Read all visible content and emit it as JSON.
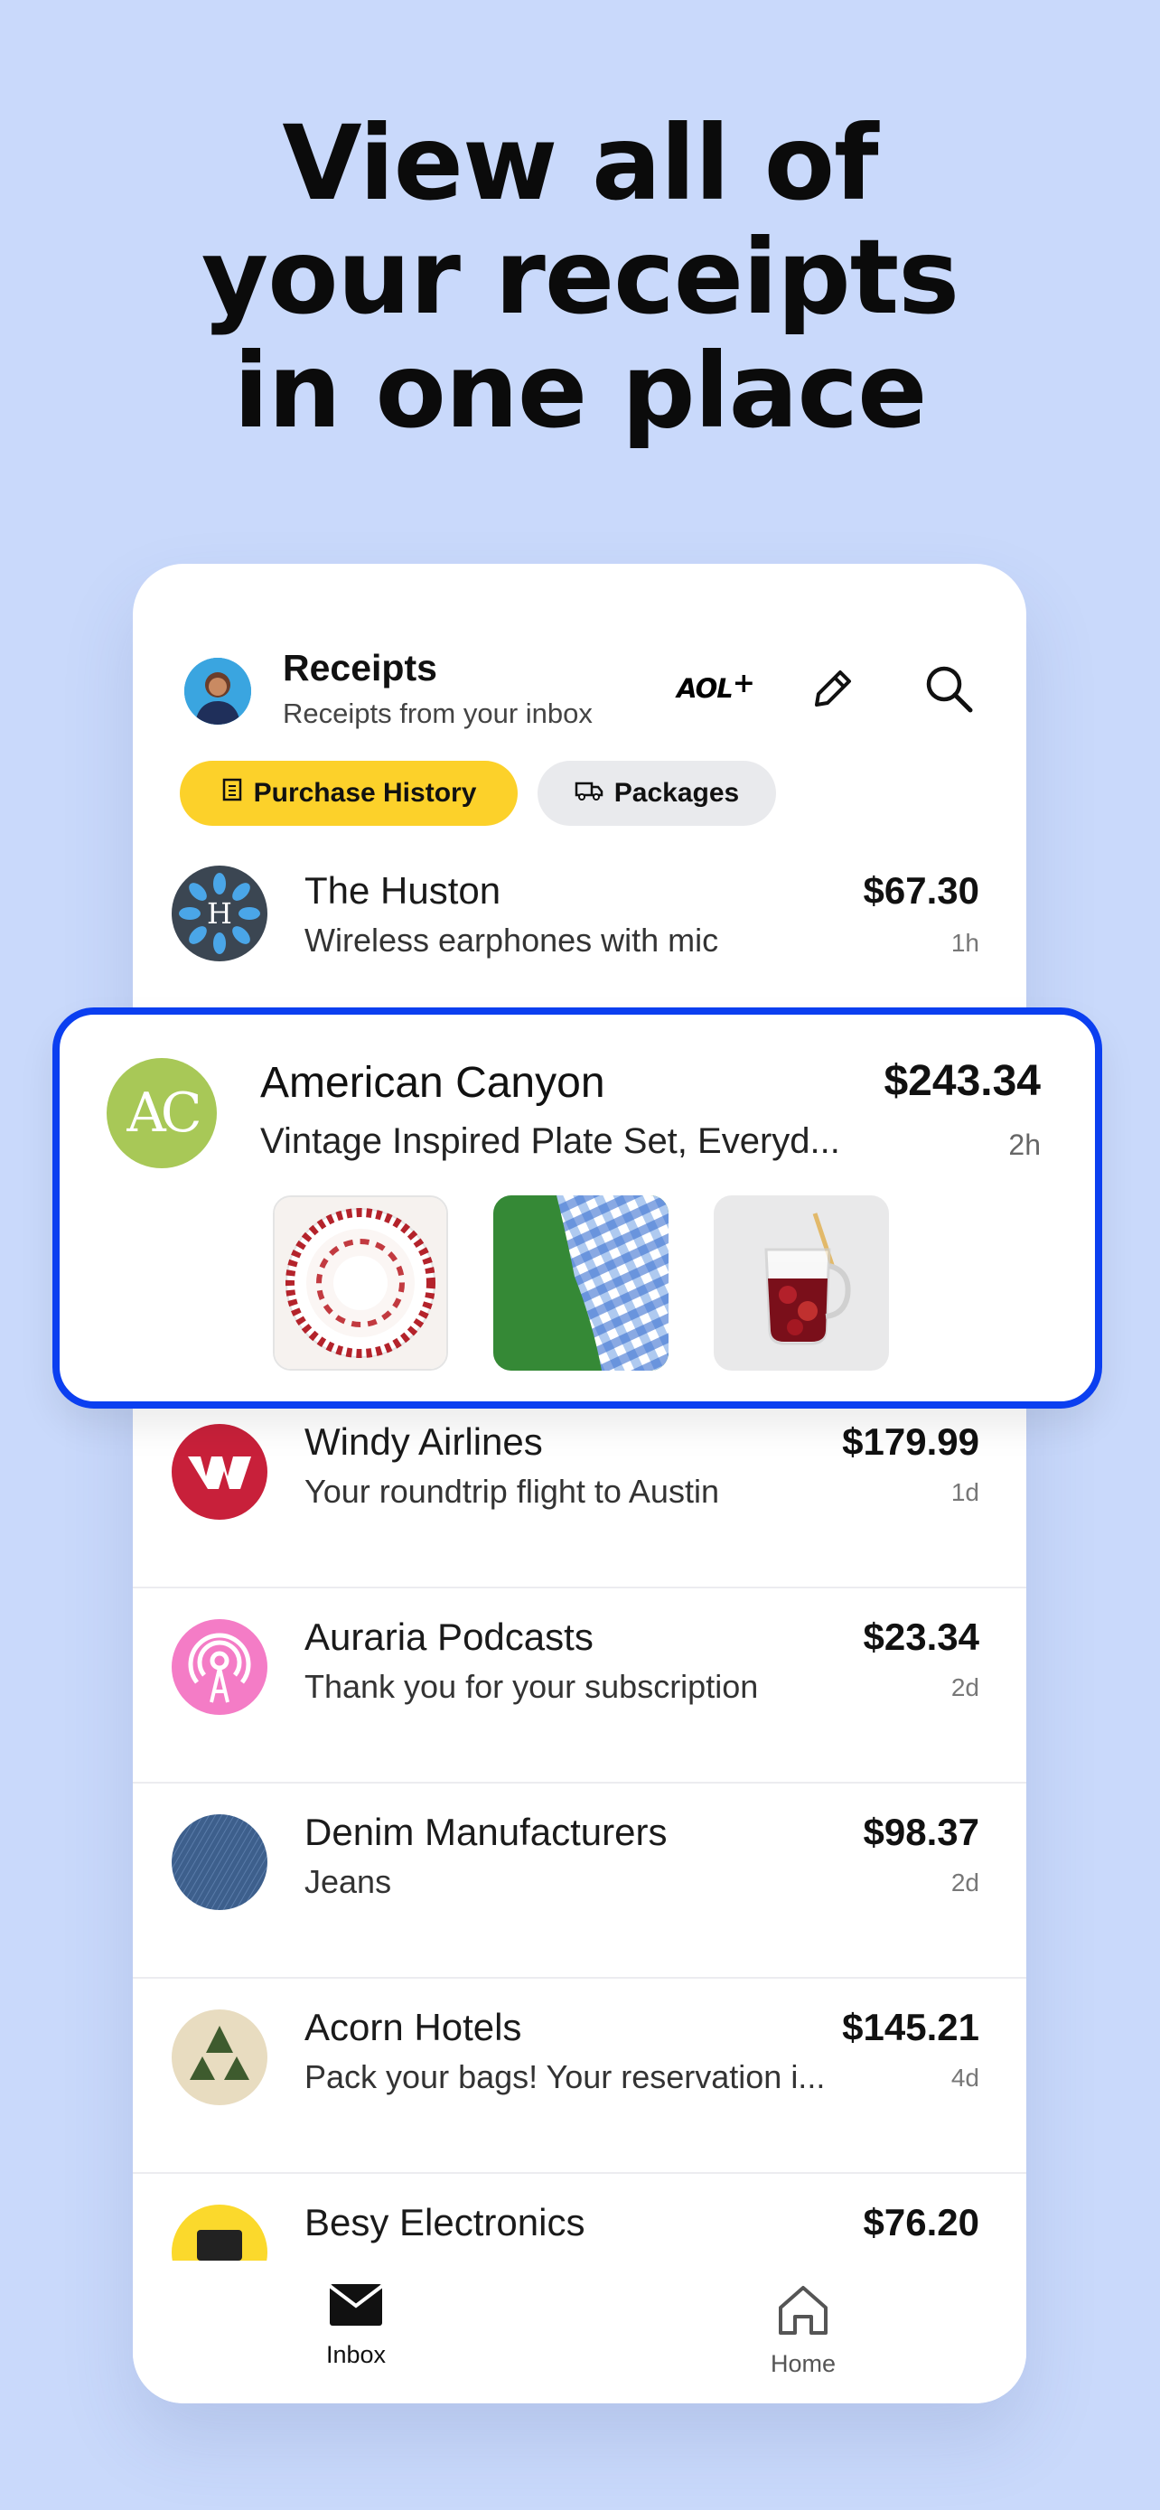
{
  "headline": [
    "View all of",
    "your receipts",
    "in one place"
  ],
  "header": {
    "title": "Receipts",
    "subtitle": "Receipts from your inbox",
    "aol_label": "AOL",
    "aol_plus": "+"
  },
  "filters": {
    "purchase_history": "Purchase History",
    "packages": "Packages"
  },
  "featured": {
    "logo_text": "AC",
    "name": "American Canyon",
    "desc": "Vintage Inspired Plate Set, Everyd...",
    "price": "$243.34",
    "time": "2h"
  },
  "receipts": [
    {
      "name": "The Huston",
      "desc": "Wireless earphones with mic",
      "price": "$67.30",
      "time": "1h",
      "logo_text": "H"
    },
    {
      "name": "Windy Airlines",
      "desc": "Your roundtrip flight to Austin",
      "price": "$179.99",
      "time": "1d"
    },
    {
      "name": "Auraria Podcasts",
      "desc": "Thank you for your subscription",
      "price": "$23.34",
      "time": "2d"
    },
    {
      "name": "Denim Manufacturers",
      "desc": "Jeans",
      "price": "$98.37",
      "time": "2d"
    },
    {
      "name": "Acorn Hotels",
      "desc": "Pack your bags! Your reservation i...",
      "price": "$145.21",
      "time": "4d"
    },
    {
      "name": "Besy Electronics",
      "price": "$76.20"
    }
  ],
  "tabs": {
    "inbox": "Inbox",
    "home": "Home"
  },
  "colors": {
    "background": "#c9d9fb",
    "accent_yellow": "#fcd12a",
    "highlight_border": "#0b3ff0"
  }
}
